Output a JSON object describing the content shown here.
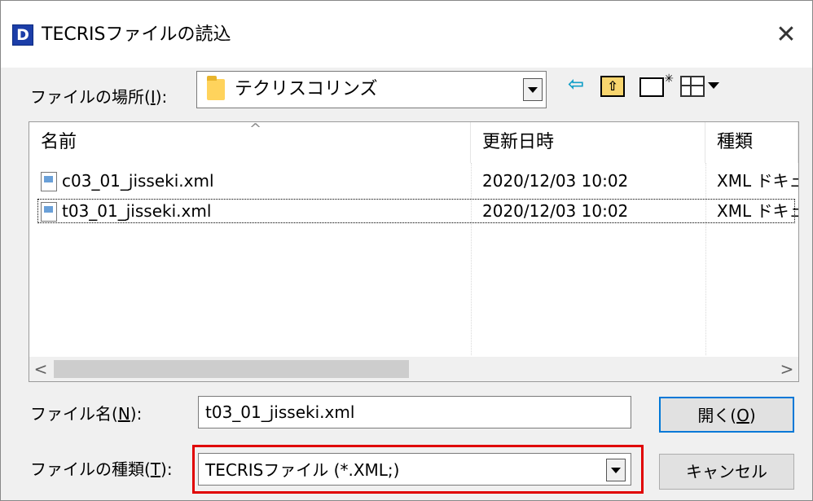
{
  "window": {
    "icon_letter": "D",
    "title": "TECRISファイルの読込",
    "close": "✕"
  },
  "lookin": {
    "label_prefix": "ファイルの場所(",
    "label_key": "I",
    "label_suffix": "):",
    "value": "テクリスコリンズ"
  },
  "toolbar": {
    "back_glyph": "⇦",
    "up_glyph": "⇧"
  },
  "list": {
    "columns": [
      "名前",
      "更新日時",
      "種類"
    ],
    "rows": [
      {
        "name": "c03_01_jisseki.xml",
        "date": "2020/12/03 10:02",
        "type": "XML ドキュ"
      },
      {
        "name": "t03_01_jisseki.xml",
        "date": "2020/12/03 10:02",
        "type": "XML ドキュ"
      }
    ],
    "sort_glyph": "^",
    "scroll_left": "<",
    "scroll_right": ">"
  },
  "filename": {
    "label_prefix": "ファイル名(",
    "label_key": "N",
    "label_suffix": "):",
    "value": "t03_01_jisseki.xml"
  },
  "filetype": {
    "label_prefix": "ファイルの種類(",
    "label_key": "T",
    "label_suffix": "):",
    "value": "TECRISファイル (*.XML;)"
  },
  "buttons": {
    "open_prefix": "開く(",
    "open_key": "O",
    "open_suffix": ")",
    "cancel": "キャンセル"
  },
  "colors": {
    "highlight": "#e00000",
    "title_icon": "#1c3ea8",
    "folder": "#ffd35c"
  }
}
